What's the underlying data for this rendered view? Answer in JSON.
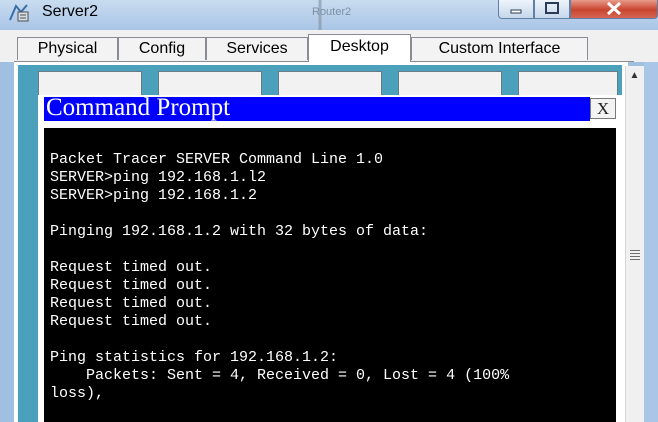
{
  "window": {
    "title": "Server2",
    "background_label": "Router2",
    "app_icon": "packet-tracer-server-icon"
  },
  "tabs": [
    {
      "label": "Physical"
    },
    {
      "label": "Config"
    },
    {
      "label": "Services"
    },
    {
      "label": "Desktop",
      "active": true
    },
    {
      "label": "Custom Interface"
    }
  ],
  "command_prompt": {
    "title": "Command Prompt",
    "close_label": "X",
    "lines": [
      "",
      "Packet Tracer SERVER Command Line 1.0",
      "SERVER>ping 192.168.1.l2",
      "SERVER>ping 192.168.1.2",
      "",
      "Pinging 192.168.1.2 with 32 bytes of data:",
      "",
      "Request timed out.",
      "Request timed out.",
      "Request timed out.",
      "Request timed out.",
      "",
      "Ping statistics for 192.168.1.2:",
      "    Packets: Sent = 4, Received = 0, Lost = 4 (100%",
      "loss),"
    ]
  },
  "colors": {
    "desktop_bg": "#4ba1bc",
    "prompt_title_bar": "#0000ff",
    "terminal_bg": "#000000",
    "terminal_text": "#ffffff"
  }
}
